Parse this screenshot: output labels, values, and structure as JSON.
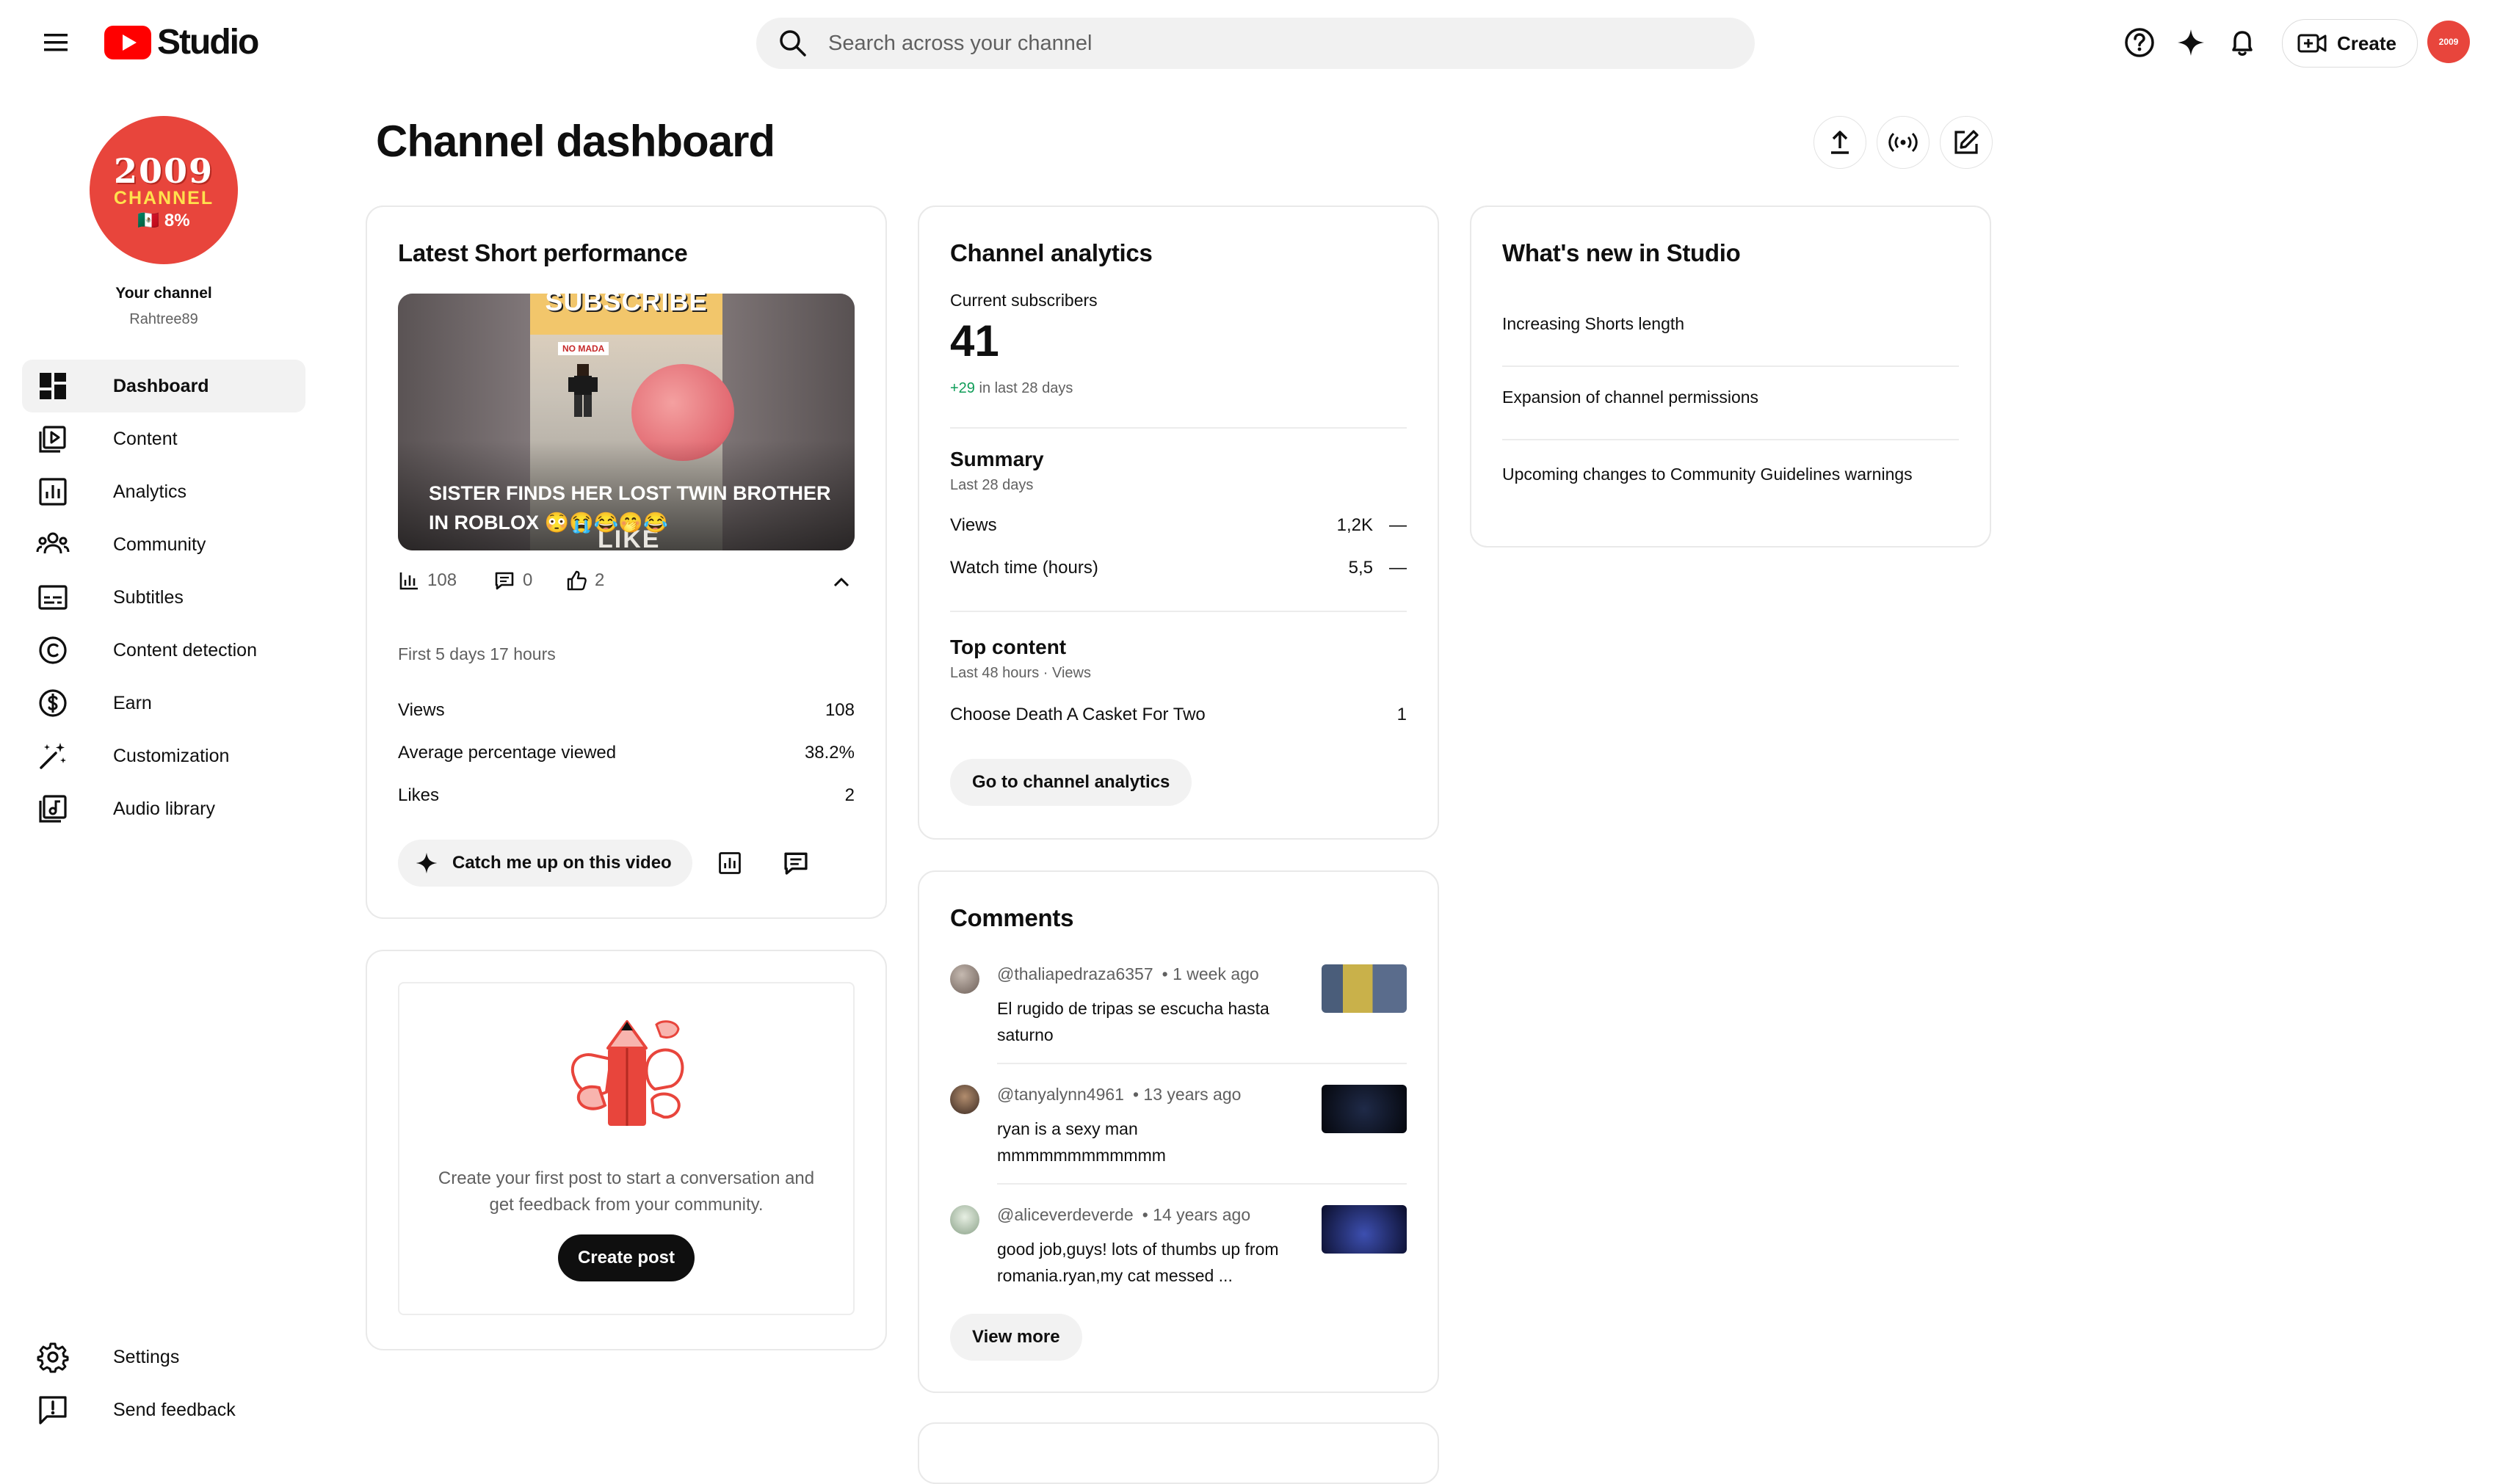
{
  "app": {
    "title": "Studio"
  },
  "search": {
    "placeholder": "Search across your channel"
  },
  "topbar": {
    "create_label": "Create"
  },
  "channel": {
    "avatar_line1": "2009",
    "avatar_line2": "CHANNEL",
    "avatar_line3": "🇲🇽 8%",
    "label": "Your channel",
    "handle": "Rahtree89"
  },
  "sidebar": {
    "items": [
      {
        "label": "Dashboard",
        "icon": "dashboard-icon"
      },
      {
        "label": "Content",
        "icon": "content-icon"
      },
      {
        "label": "Analytics",
        "icon": "analytics-icon"
      },
      {
        "label": "Community",
        "icon": "community-icon"
      },
      {
        "label": "Subtitles",
        "icon": "subtitles-icon"
      },
      {
        "label": "Content detection",
        "icon": "copyright-icon"
      },
      {
        "label": "Earn",
        "icon": "dollar-icon"
      },
      {
        "label": "Customization",
        "icon": "magic-wand-icon"
      },
      {
        "label": "Audio library",
        "icon": "audio-library-icon"
      }
    ],
    "bottom": [
      {
        "label": "Settings",
        "icon": "gear-icon"
      },
      {
        "label": "Send feedback",
        "icon": "feedback-icon"
      }
    ]
  },
  "page": {
    "title": "Channel dashboard"
  },
  "short_card": {
    "title": "Latest Short performance",
    "video_title": "SISTER FINDS HER LOST TWIN BROTHER IN ROBLOX 😳😭😂🤭😂",
    "thumb_banner": "SUBSCRIBE",
    "thumb_tag": "NO MADA",
    "thumb_like": "LIKE",
    "views_count": "108",
    "comments_count": "0",
    "likes_count": "2",
    "period": "First 5 days 17 hours",
    "stats": [
      {
        "label": "Views",
        "value": "108"
      },
      {
        "label": "Average percentage viewed",
        "value": "38.2%"
      },
      {
        "label": "Likes",
        "value": "2"
      }
    ],
    "catch_up_label": "Catch me up on this video"
  },
  "post_card": {
    "text": "Create your first post to start a conversation and get feedback from your community.",
    "button": "Create post"
  },
  "analytics": {
    "title": "Channel analytics",
    "subs_label": "Current subscribers",
    "subs_value": "41",
    "subs_delta": "+29",
    "subs_delta_suffix": " in last 28 days",
    "summary_title": "Summary",
    "summary_period": "Last 28 days",
    "summary_rows": [
      {
        "label": "Views",
        "value": "1,2K",
        "trend": "—"
      },
      {
        "label": "Watch time (hours)",
        "value": "5,5",
        "trend": "—"
      }
    ],
    "top_title": "Top content",
    "top_period": "Last 48 hours · Views",
    "top_rows": [
      {
        "label": "Choose Death A Casket For Two",
        "value": "1"
      }
    ],
    "button": "Go to channel analytics"
  },
  "comments": {
    "title": "Comments",
    "items": [
      {
        "user": "@thaliapedraza6357",
        "time": "• 1 week ago",
        "text": "El rugido de tripas se escucha hasta saturno"
      },
      {
        "user": "@tanyalynn4961",
        "time": "• 13 years ago",
        "text": "ryan is a sexy man mmmmmmmmmmmm"
      },
      {
        "user": "@aliceverdeverde",
        "time": "• 14 years ago",
        "text": "good job,guys!  lots of thumbs up from romania.ryan,my cat messed ..."
      }
    ],
    "button": "View more"
  },
  "whats_new": {
    "title": "What's new in Studio",
    "items": [
      "Increasing Shorts length",
      "Expansion of channel permissions",
      "Upcoming changes to Community Guidelines warnings"
    ]
  },
  "colors": {
    "brand_red": "#ff0000",
    "accent_green": "#0f9d58",
    "avatar_red": "#e8453c"
  }
}
